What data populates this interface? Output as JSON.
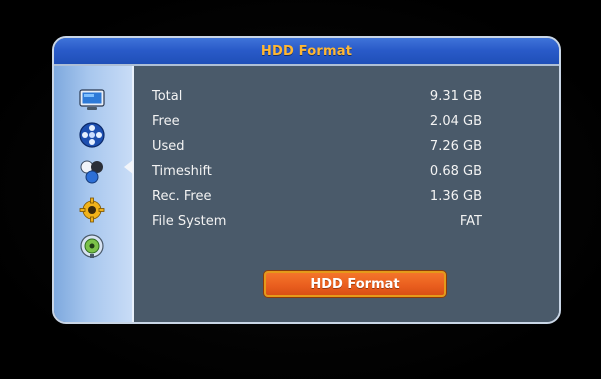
{
  "window": {
    "title": "HDD Format"
  },
  "sidebar": {
    "items": [
      {
        "icon": "tv-icon"
      },
      {
        "icon": "film-reel-icon",
        "selected": true
      },
      {
        "icon": "three-balls-icon"
      },
      {
        "icon": "gear-icon"
      },
      {
        "icon": "satellite-dish-icon"
      }
    ]
  },
  "info": {
    "rows": [
      {
        "label": "Total",
        "value": "9.31 GB"
      },
      {
        "label": "Free",
        "value": "2.04 GB"
      },
      {
        "label": "Used",
        "value": "7.26 GB"
      },
      {
        "label": "Timeshift",
        "value": "0.68 GB"
      },
      {
        "label": "Rec. Free",
        "value": "1.36 GB"
      },
      {
        "label": "File System",
        "value": "FAT"
      }
    ]
  },
  "actions": {
    "format_label": "HDD Format"
  },
  "colors": {
    "title_text": "#ffb733",
    "titlebar_blue": "#2a5bc9",
    "panel_bg": "#4a5a6a",
    "button_orange": "#ea5f1f"
  }
}
